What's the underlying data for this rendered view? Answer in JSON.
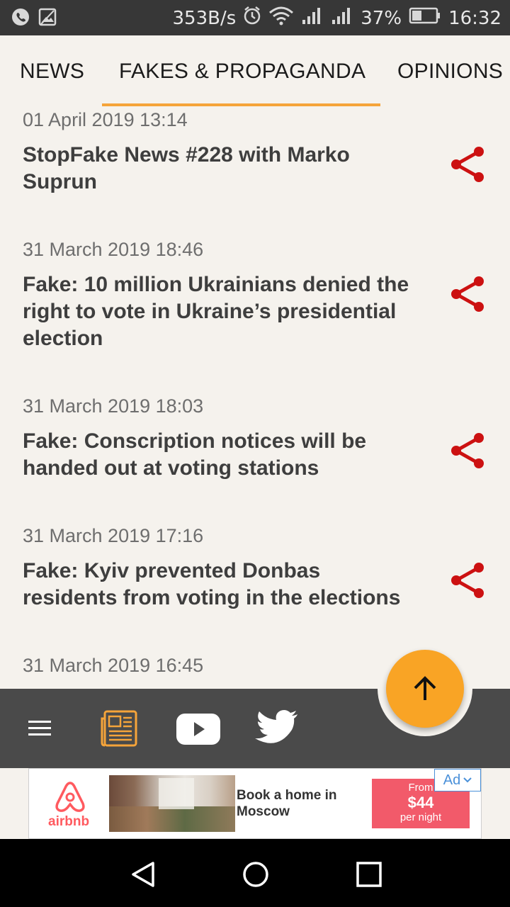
{
  "status_bar": {
    "speed": "353B/s",
    "battery": "37%",
    "time": "16:32"
  },
  "tabs": [
    {
      "label": "NEWS",
      "active": false
    },
    {
      "label": "FAKES & PROPAGANDA",
      "active": true
    },
    {
      "label": "OPINIONS",
      "active": false
    }
  ],
  "articles": [
    {
      "date": "01 April 2019 13:14",
      "title": "StopFake News #228 with Marko Suprun"
    },
    {
      "date": "31 March 2019 18:46",
      "title": "Fake: 10 million Ukrainians denied the right to vote in Ukraine’s presidential election"
    },
    {
      "date": "31 March 2019 18:03",
      "title": "Fake: Conscription notices will be handed out at voting stations"
    },
    {
      "date": "31 March 2019 17:16",
      "title": "Fake: Kyiv prevented Donbas residents from voting in the elections"
    },
    {
      "date": "31 March 2019 16:45",
      "title": ""
    }
  ],
  "toolbar": {
    "icons": [
      "menu-icon",
      "newspaper-icon",
      "youtube-icon",
      "twitter-icon"
    ],
    "fab_icon": "arrow-up-icon"
  },
  "ad": {
    "brand": "airbnb",
    "headline": "Book a home in Moscow",
    "price_from": "From",
    "price": "$44",
    "price_unit": "per night",
    "badge": "Ad"
  },
  "colors": {
    "accent": "#f5a43a",
    "share": "#cc1111",
    "toolbar": "#4a4a4a",
    "ad_price_bg": "#f25a6a",
    "airbnb": "#ff5a5f"
  }
}
